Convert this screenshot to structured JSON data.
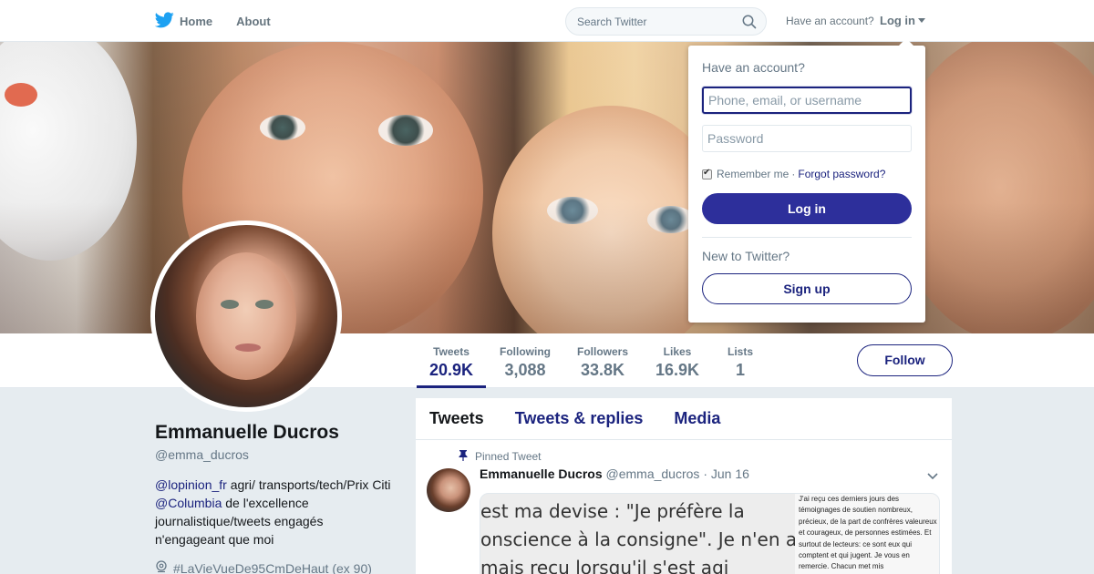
{
  "nav": {
    "home_label": "Home",
    "about_label": "About",
    "search_placeholder": "Search Twitter",
    "have_account": "Have an account?",
    "login_label": "Log in"
  },
  "profile": {
    "name": "Emmanuelle Ducros",
    "handle": "@emma_ducros",
    "bio_mention1": "@lopinion_fr",
    "bio_text1": " agri/ transports/tech/Prix Citi ",
    "bio_mention2": "@Columbia",
    "bio_text2": " de l'excellence journalistique/tweets engagés n'engageant que moi",
    "location": "#LaVieVueDe95CmDeHaut (ex 90)"
  },
  "stats": [
    {
      "label": "Tweets",
      "value": "20.9K"
    },
    {
      "label": "Following",
      "value": "3,088"
    },
    {
      "label": "Followers",
      "value": "33.8K"
    },
    {
      "label": "Likes",
      "value": "16.9K"
    },
    {
      "label": "Lists",
      "value": "1"
    }
  ],
  "follow_label": "Follow",
  "timeline": {
    "tabs": [
      "Tweets",
      "Tweets & replies",
      "Media"
    ],
    "pinned_label": "Pinned Tweet",
    "tweet": {
      "name": "Emmanuelle Ducros",
      "handle": "@emma_ducros",
      "date": "· Jun 16",
      "image_text_large": "est ma devise : \"Je préfère la\nonscience à la consigne\". Je n'en a\nmais reçu lorsqu'il s'est agi",
      "image_text_small": "J'ai reçu ces derniers jours des témoignages de soutien nombreux, précieux, de la part de confrères valeureux et courageux, de personnes estimées. Et surtout de lecteurs: ce sont eux qui comptent et qui jugent.\nJe vous en remercie. Chacun met mis"
    }
  },
  "login_dropdown": {
    "title": "Have an account?",
    "username_placeholder": "Phone, email, or username",
    "password_placeholder": "Password",
    "remember_label": "Remember me",
    "separator": "·",
    "forgot_label": "Forgot password?",
    "login_button": "Log in",
    "new_label": "New to Twitter?",
    "signup_button": "Sign up"
  },
  "colors": {
    "accent": "#1b237e",
    "login_button_bg": "#2d2f9b",
    "twitter_blue": "#1da1f2",
    "background": "#e6ecf0"
  },
  "icons": [
    "twitter-bird-icon",
    "search-icon",
    "caret-down-icon",
    "pin-icon",
    "chevron-down-icon",
    "location-pin-icon"
  ]
}
